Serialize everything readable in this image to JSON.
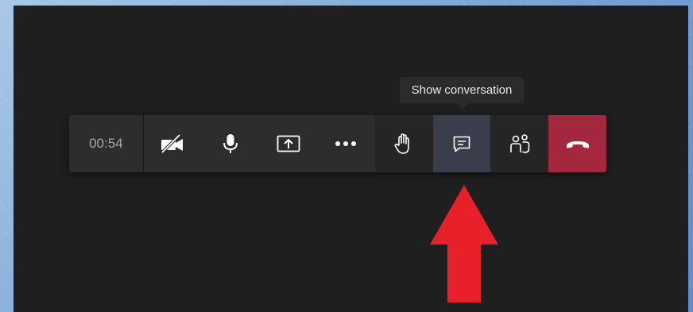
{
  "call": {
    "duration": "00:54"
  },
  "tooltip": {
    "text": "Show conversation"
  },
  "toolbar": {
    "buttons": [
      {
        "id": "camera",
        "icon": "camera-off-icon"
      },
      {
        "id": "microphone",
        "icon": "microphone-icon"
      },
      {
        "id": "share",
        "icon": "share-screen-icon"
      },
      {
        "id": "more",
        "icon": "more-actions-icon"
      },
      {
        "id": "raise-hand",
        "icon": "raise-hand-icon"
      },
      {
        "id": "conversation",
        "icon": "chat-bubble-icon",
        "state": "hovered"
      },
      {
        "id": "participants",
        "icon": "participants-icon"
      },
      {
        "id": "hang-up",
        "icon": "hang-up-icon"
      }
    ]
  },
  "colors": {
    "window_background": "#1f1f1f",
    "toolbar_background": "#2d2d2d",
    "hover_highlight": "#3a3d4c",
    "hang_up": "#a4283d",
    "annotation_arrow": "#e8202a"
  }
}
